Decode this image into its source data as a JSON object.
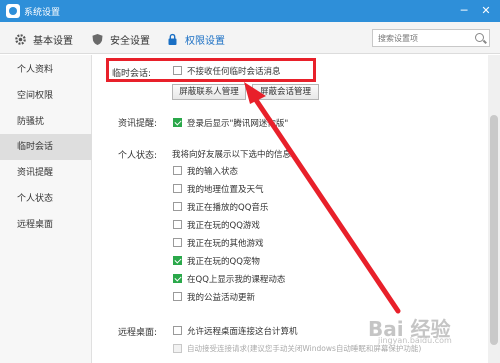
{
  "window": {
    "title": "系统设置",
    "minimize_glyph": "─",
    "close_glyph": "✕"
  },
  "tabs": [
    {
      "label": "基本设置",
      "icon": "gear-icon",
      "active": false
    },
    {
      "label": "安全设置",
      "icon": "shield-icon",
      "active": false
    },
    {
      "label": "权限设置",
      "icon": "lock-icon",
      "active": true
    }
  ],
  "search": {
    "placeholder": "搜索设置项"
  },
  "sidebar": {
    "items": [
      {
        "label": "个人资料",
        "active": false
      },
      {
        "label": "空间权限",
        "active": false
      },
      {
        "label": "防骚扰",
        "active": false
      },
      {
        "label": "临时会话",
        "active": true
      },
      {
        "label": "资讯提醒",
        "active": false
      },
      {
        "label": "个人状态",
        "active": false
      },
      {
        "label": "远程桌面",
        "active": false
      }
    ]
  },
  "temp_session": {
    "label": "临时会话:",
    "option": "不接收任何临时会话消息",
    "checked": false,
    "btn_block_contacts": "屏蔽联系人管理",
    "btn_block_sessions": "屏蔽会话管理"
  },
  "news": {
    "label": "资讯提醒:",
    "option": "登录后显示\"腾讯网迷你版\"",
    "checked": true
  },
  "status": {
    "label": "个人状态:",
    "intro": "我将向好友展示以下选中的信息:",
    "options": [
      {
        "text": "我的输入状态",
        "checked": false
      },
      {
        "text": "我的地理位置及天气",
        "checked": false
      },
      {
        "text": "我正在播放的QQ音乐",
        "checked": false
      },
      {
        "text": "我正在玩的QQ游戏",
        "checked": false
      },
      {
        "text": "我正在玩的其他游戏",
        "checked": false
      },
      {
        "text": "我正在玩的QQ宠物",
        "checked": true
      },
      {
        "text": "在QQ上显示我的课程动态",
        "checked": true
      },
      {
        "text": "我的公益活动更新",
        "checked": false
      }
    ]
  },
  "remote": {
    "label": "远程桌面:",
    "option1": "允许远程桌面连接这台计算机",
    "option2": "自动接受连接请求(建议您手动关闭Windows自动睡眠和屏幕保护功能)"
  },
  "watermark": {
    "text": "Bai 经验",
    "sub": "jingyan.baidu.com"
  },
  "colors": {
    "accent": "#2e8fd9",
    "highlight_box": "#e8202a",
    "check_green": "#2aa84a"
  }
}
